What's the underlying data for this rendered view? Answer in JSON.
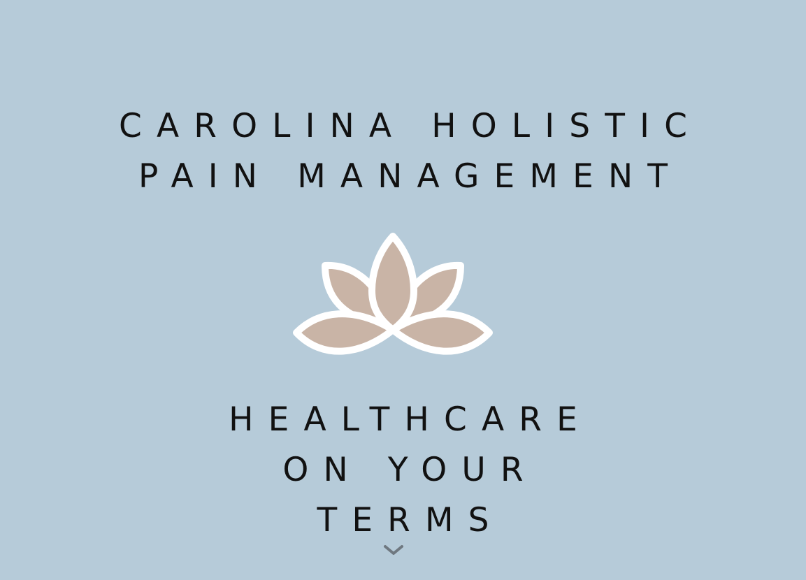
{
  "hero": {
    "title_lines": [
      "CAROLINA HOLISTIC",
      "PAIN MANAGEMENT"
    ],
    "tagline_lines": [
      "HEALTHCARE",
      "ON YOUR",
      "TERMS"
    ],
    "logo_icon": "lotus-icon",
    "scroll_icon": "chevron-down-icon"
  },
  "colors": {
    "background": "#b6cbd9",
    "text": "#111111",
    "lotus_petal": "#c9b4a6",
    "lotus_outline": "#ffffff",
    "chevron": "#6f7880"
  }
}
